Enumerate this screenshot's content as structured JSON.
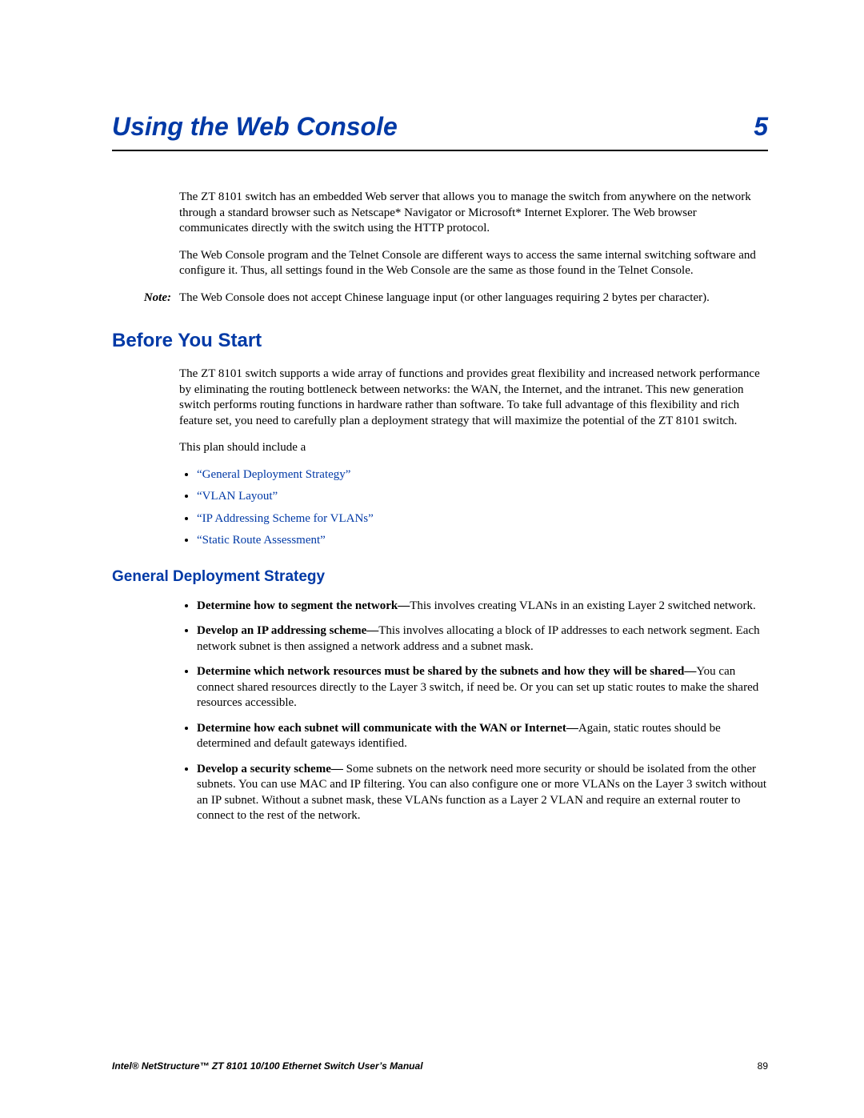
{
  "chapter": {
    "title": "Using the Web Console",
    "number": "5"
  },
  "intro": {
    "p1": "The ZT 8101 switch has an embedded Web server that allows you to manage the switch from anywhere on the network through a standard browser such as Netscape* Navigator or Microsoft* Internet Explorer. The Web browser communicates directly with the switch using the HTTP protocol.",
    "p2": "The Web Console program and the Telnet Console are different ways to access the same internal switching software and configure it. Thus, all settings found in the Web Console are the same as those found in the Telnet Console."
  },
  "note": {
    "label": "Note:",
    "text": "The Web Console does not accept Chinese language input (or other languages requiring 2 bytes per character)."
  },
  "section1": {
    "title": "Before You Start",
    "p1": "The ZT 8101 switch supports a wide array of functions and provides great flexibility and increased network performance by eliminating the routing bottleneck between networks: the WAN, the Internet, and the intranet. This new generation switch performs routing functions in hardware rather than software. To take full advantage of this flexibility and rich feature set, you need to carefully plan a deployment strategy that will maximize the potential of the ZT 8101 switch.",
    "p2": "This plan should include a",
    "links": [
      "“General Deployment Strategy”",
      "“VLAN Layout”",
      "“IP Addressing Scheme for VLANs”",
      "“Static Route Assessment”"
    ]
  },
  "section2": {
    "title": "General Deployment Strategy",
    "items": [
      {
        "bold": "Determine how to segment the network—",
        "text": "This involves creating VLANs in an existing Layer 2 switched network."
      },
      {
        "bold": "Develop an IP addressing scheme—",
        "text": "This involves allocating a block of IP addresses to each network segment. Each network subnet is then assigned a network address and a subnet mask."
      },
      {
        "bold": "Determine which network resources must be shared by the subnets and how they will be shared—",
        "text": "You can connect shared resources directly to the Layer 3 switch, if need be. Or you can set up static routes to make the shared resources accessible."
      },
      {
        "bold": "Determine how each subnet will communicate with the WAN or Internet—",
        "text": "Again, static routes should be determined and default gateways identified."
      },
      {
        "bold": "Develop a security scheme—",
        "text": " Some subnets on the network need more security or should be isolated from the other subnets. You can use MAC and IP filtering. You can also configure one or more VLANs on the Layer 3 switch without an IP subnet. Without a subnet mask, these VLANs function as a Layer 2 VLAN and require an external router to connect to the rest of the network."
      }
    ]
  },
  "footer": {
    "title": "Intel® NetStructure™  ZT 8101 10/100 Ethernet Switch User’s Manual",
    "page": "89"
  }
}
